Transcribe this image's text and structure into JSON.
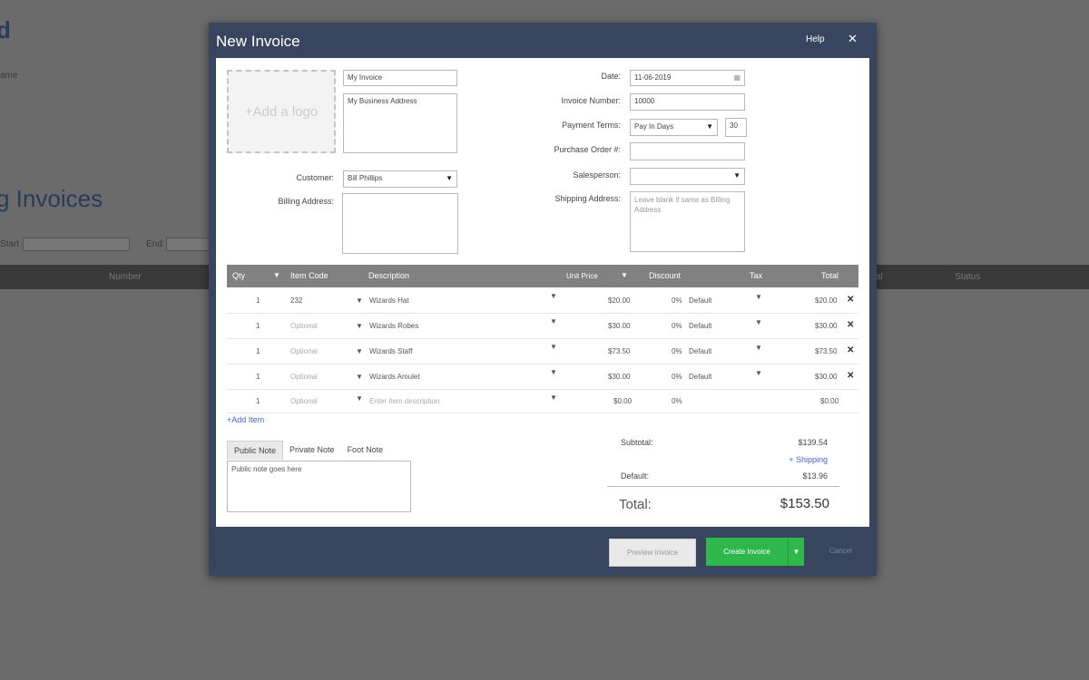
{
  "background": {
    "heading_top": "d",
    "name_label": "ame",
    "right_text": "",
    "page_title": "g Invoices",
    "start_label": "Start",
    "end_label": "End",
    "table_columns": [
      "Number",
      "al",
      "Status"
    ]
  },
  "modal": {
    "title": "New Invoice",
    "help_label": "Help",
    "close_icon": "close-icon",
    "logo_placeholder": "+Add a logo",
    "invoice_title": "My Invoice",
    "business_address": "My Business Address",
    "customer_label": "Customer:",
    "customer_value": "Bill Phillips",
    "billing_address_label": "Billing Address:",
    "billing_address_value": "",
    "date_label": "Date:",
    "date_value": "11-06-2019",
    "invoice_number_label": "Invoice Number:",
    "invoice_number_value": "10000",
    "payment_terms_label": "Payment Terms:",
    "payment_terms_value": "Pay In Days",
    "payment_days_value": "30",
    "po_label": "Purchase Order #:",
    "po_value": "",
    "salesperson_label": "Salesperson:",
    "salesperson_value": "",
    "shipping_address_label": "Shipping Address:",
    "shipping_address_placeholder": "Leave blank if same as Billing Address"
  },
  "items": {
    "columns": {
      "qty": "Qty",
      "item_code": "Item Code",
      "description": "Description",
      "unit_price": "Unit Price",
      "discount": "Discount",
      "tax": "Tax",
      "total": "Total"
    },
    "rows": [
      {
        "qty": "1",
        "code": "232",
        "description": "Wizards Hat",
        "unit_price": "$20.00",
        "discount": "0%",
        "tax": "Default",
        "total": "$20.00"
      },
      {
        "qty": "1",
        "code": "Optional",
        "description": "Wizards Robes",
        "unit_price": "$30.00",
        "discount": "0%",
        "tax": "Default",
        "total": "$30.00"
      },
      {
        "qty": "1",
        "code": "Optional",
        "description": "Wizards Staff",
        "unit_price": "$73.50",
        "discount": "0%",
        "tax": "Default",
        "total": "$73.50"
      },
      {
        "qty": "1",
        "code": "Optional",
        "description": "Wizards Amulet",
        "unit_price": "$30.00",
        "discount": "0%",
        "tax": "Default",
        "total": "$30.00"
      },
      {
        "qty": "1",
        "code": "Optional",
        "description": "Enter item description",
        "unit_price": "$0.00",
        "discount": "0%",
        "tax": "",
        "total": "$0.00"
      }
    ],
    "add_item_label": "+Add Item"
  },
  "notes": {
    "tabs": [
      "Public Note",
      "Private Note",
      "Foot Note"
    ],
    "active_tab": "Public Note",
    "public_note_placeholder": "Public note goes here"
  },
  "totals": {
    "subtotal_label": "Subtotal:",
    "subtotal_value": "$139.54",
    "shipping_link": "+ Shipping",
    "tax_label": "Default:",
    "tax_value": "$13.96",
    "total_label": "Total:",
    "total_value": "$153.50"
  },
  "footer": {
    "preview_label": "Preview Invoice",
    "create_label": "Create Invoice",
    "cancel_label": "Cancel"
  },
  "colors": {
    "modal_frame": "#37455f",
    "create_button": "#2eb84b",
    "link": "#4a5fd0",
    "table_header": "#818181"
  }
}
